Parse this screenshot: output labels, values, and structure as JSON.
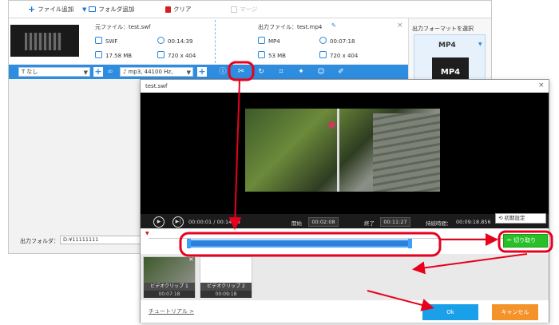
{
  "toolbar": {
    "add_file": "ファイル追加",
    "add_folder": "フォルダ追加",
    "clear": "クリア",
    "merge": "マージ"
  },
  "file": {
    "source_label": "元ファイル：test.swf",
    "source_format": "SWF",
    "source_duration": "00:14:39",
    "source_size": "17.58 MB",
    "source_resolution": "720 x 404",
    "output_label": "出力ファイル：test.mp4",
    "output_format": "MP4",
    "output_duration": "00:07:18",
    "output_size": "53 MB",
    "output_resolution": "720 x 404"
  },
  "bluebar": {
    "subtitle_value": "なし",
    "audio_value": "mp3, 44100 Hz,"
  },
  "right_panel": {
    "title": "出力フォーマットを選択",
    "format": "MP4",
    "card_text": "MP4"
  },
  "output_folder": {
    "label": "出力フォルダ：",
    "value": "D:¥11111111"
  },
  "dialog": {
    "title": "test.swf",
    "current_time": "00:00:01 / 00:14:39",
    "start_label": "開始",
    "start_value": "00:02:08",
    "end_label": "終了",
    "end_value": "00:11:27",
    "duration_label": "持続時間：",
    "duration_value": "00:09:18.856",
    "reset_label": "初期設定",
    "cut_label": "切り取り",
    "clips": [
      {
        "name": "ビデオクリップ 1",
        "duration": "00:07:18"
      },
      {
        "name": "ビデオクリップ 2",
        "duration": "00:09:18"
      }
    ],
    "tutorial": "チュートリアル >",
    "ok": "Ok",
    "cancel": "キャンセル"
  },
  "colors": {
    "accent_blue": "#2f8de0",
    "annotation_red": "#e8001c",
    "cut_green": "#28c028",
    "cancel_orange": "#f5932b",
    "ok_blue": "#1aa0e8"
  }
}
